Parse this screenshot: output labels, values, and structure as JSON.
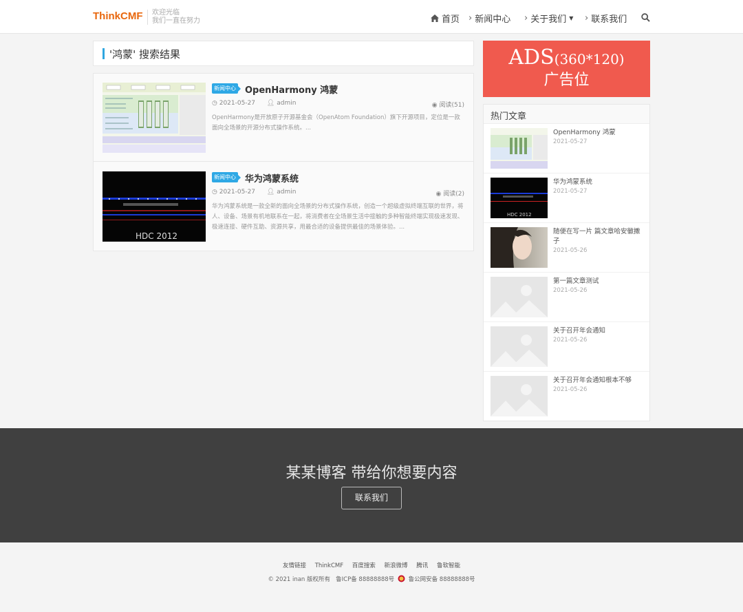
{
  "header": {
    "logo": "ThinkCMF",
    "slogan_line1": "欢迎光临",
    "slogan_line2": "我们一直在努力",
    "nav": {
      "home": "首页",
      "news": "新闻中心",
      "about": "关于我们",
      "contact": "联系我们"
    },
    "icons": {
      "home": "home-icon",
      "search": "search-icon"
    }
  },
  "search": {
    "title": "'鸿蒙' 搜索结果",
    "results": [
      {
        "category": "新闻中心",
        "title": "OpenHarmony 鸿蒙",
        "date": "2021-05-27",
        "author": "admin",
        "reads": "阅读(51)",
        "excerpt": "OpenHarmony是开放原子开源基金会（OpenAtom Foundation）旗下开源项目，定位是一款面向全场景的开源分布式操作系统。..."
      },
      {
        "category": "新闻中心",
        "title": "华为鸿蒙系统",
        "date": "2021-05-27",
        "author": "admin",
        "reads": "阅读(2)",
        "excerpt": "华为鸿蒙系统是一款全新的面向全场景的分布式操作系统，创造一个超级虚拟终端互联的世界，将人、设备、场景有机地联系在一起，将消费者在全场景生活中接触的多种智能终端实现极速发现、极速连接、硬件互助、资源共享，用最合适的设备提供最佳的场景体验。..."
      }
    ]
  },
  "ad": {
    "line1": "ADS",
    "size": "(360*120)",
    "line2": "广告位"
  },
  "hot": {
    "title": "热门文章",
    "items": [
      {
        "title": "OpenHarmony 鸿蒙",
        "date": "2021-05-27"
      },
      {
        "title": "华为鸿蒙系统",
        "date": "2021-05-27"
      },
      {
        "title": "随便在写一片 篇文章哈安徽撒子",
        "date": "2021-05-26"
      },
      {
        "title": "第一篇文章测试",
        "date": "2021-05-26"
      },
      {
        "title": "关于召开年会通知",
        "date": "2021-05-26"
      },
      {
        "title": "关于召开年会通知根本不够",
        "date": "2021-05-26"
      }
    ]
  },
  "banner": {
    "title": "某某博客 带给你想要内容",
    "button": "联系我们"
  },
  "footer": {
    "links": [
      "友情链接",
      "ThinkCMF",
      "百度搜索",
      "新浪微博",
      "腾讯",
      "鲁软智能"
    ],
    "copyright": "© 2021 inan 版权所有",
    "icp": "鲁ICP备 88888888号",
    "police": "鲁公网安备 88888888号"
  },
  "colors": {
    "accent": "#2fa6e0",
    "brand": "#e8670d",
    "ad_bg": "#f05a4e",
    "banner_bg": "#404040"
  }
}
